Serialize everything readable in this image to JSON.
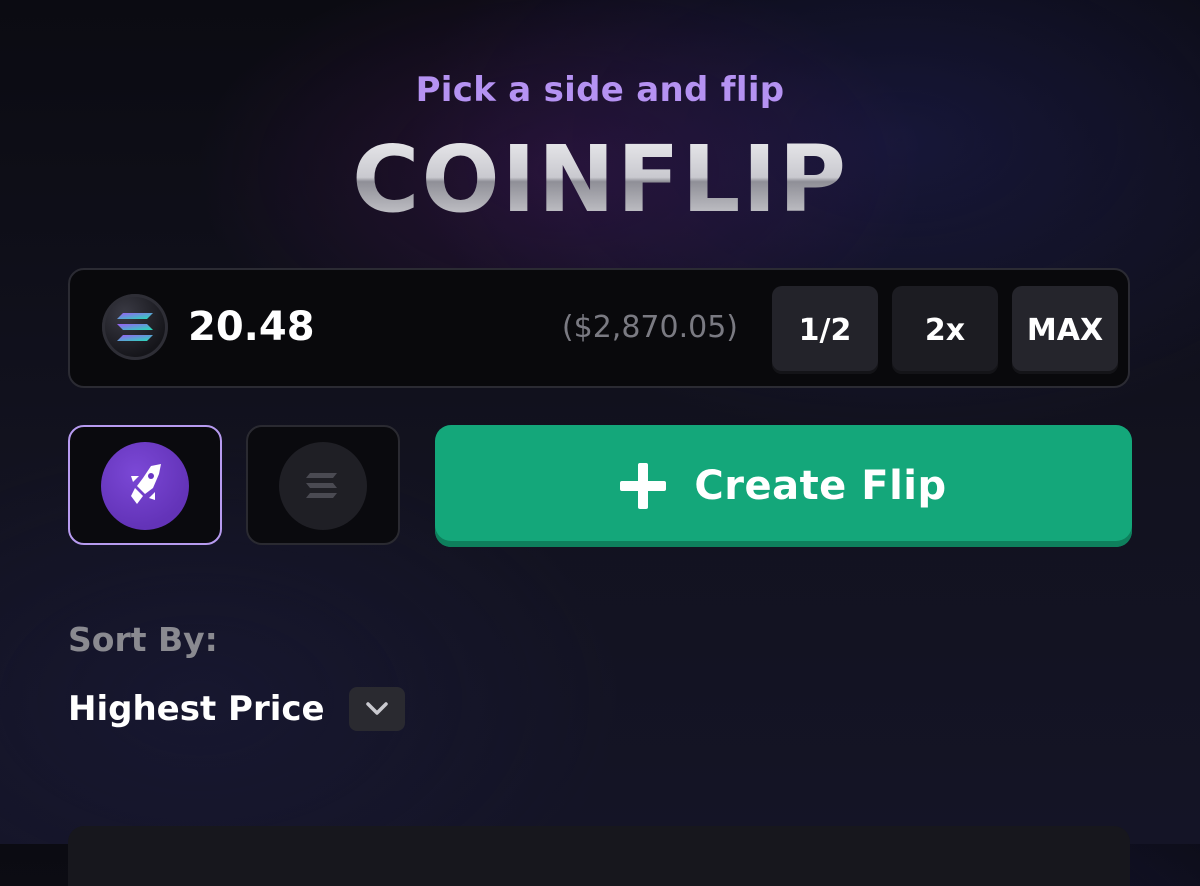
{
  "header": {
    "subtitle": "Pick a side and flip",
    "title": "COINFLIP"
  },
  "bet": {
    "currency_icon": "solana-coin-icon",
    "amount": "20.48",
    "usd_value": "($2,870.05)",
    "half_label": "1/2",
    "double_label": "2x",
    "max_label": "MAX"
  },
  "sides": {
    "side_a_icon": "rocket-coin-icon",
    "side_a_selected": true,
    "side_b_icon": "solana-coin-icon",
    "side_a_color": "#6a37c4",
    "side_a_border": "#b79bf0"
  },
  "create": {
    "icon": "plus-icon",
    "label": "Create Flip",
    "color": "#14a77a"
  },
  "sort": {
    "label": "Sort By:",
    "selected": "Highest Price",
    "icon": "chevron-down-icon"
  },
  "theme": {
    "accent_purple": "#b592f2",
    "background": "#0e0e16"
  }
}
